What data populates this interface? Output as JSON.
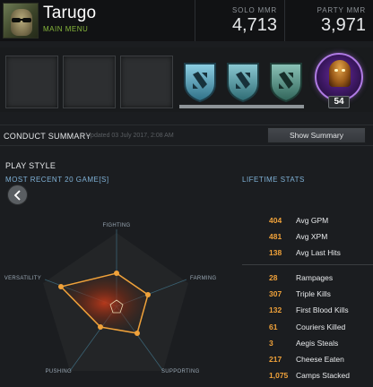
{
  "player": {
    "name": "Tarugo",
    "main_menu_label": "MAIN MENU"
  },
  "mmr": {
    "solo_label": "SOLO MMR",
    "solo_value": "4,713",
    "party_label": "PARTY MMR",
    "party_value": "3,971"
  },
  "badges": {
    "empty_slots": 3,
    "shields": [
      {
        "icon": "dota-shield-icon",
        "color": "#5ea6bd"
      },
      {
        "icon": "dota-shield-icon",
        "color": "#5e9fa6"
      },
      {
        "icon": "dota-shield-icon",
        "color": "#5f8f86"
      }
    ],
    "level": "54"
  },
  "conduct": {
    "title": "CONDUCT SUMMARY",
    "updated": "Updated 03 July 2017, 2:08 AM",
    "button_label": "Show Summary"
  },
  "play_style": {
    "title": "PLAY STYLE",
    "recent_label": "MOST RECENT 20 GAME[S]",
    "lifetime_label": "LIFETIME STATS",
    "axes": [
      "FIGHTING",
      "FARMING",
      "SUPPORTING",
      "PUSHING",
      "VERSATILITY"
    ],
    "accent_color": "#f0a23a"
  },
  "stats": {
    "top": [
      {
        "value": "404",
        "label": "Avg GPM"
      },
      {
        "value": "481",
        "label": "Avg XPM"
      },
      {
        "value": "138",
        "label": "Avg Last Hits"
      }
    ],
    "bottom": [
      {
        "value": "28",
        "label": "Rampages"
      },
      {
        "value": "307",
        "label": "Triple Kills"
      },
      {
        "value": "132",
        "label": "First Blood Kills"
      },
      {
        "value": "61",
        "label": "Couriers Killed"
      },
      {
        "value": "3",
        "label": "Aegis Steals"
      },
      {
        "value": "217",
        "label": "Cheese Eaten"
      },
      {
        "value": "1,075",
        "label": "Camps Stacked"
      }
    ]
  }
}
